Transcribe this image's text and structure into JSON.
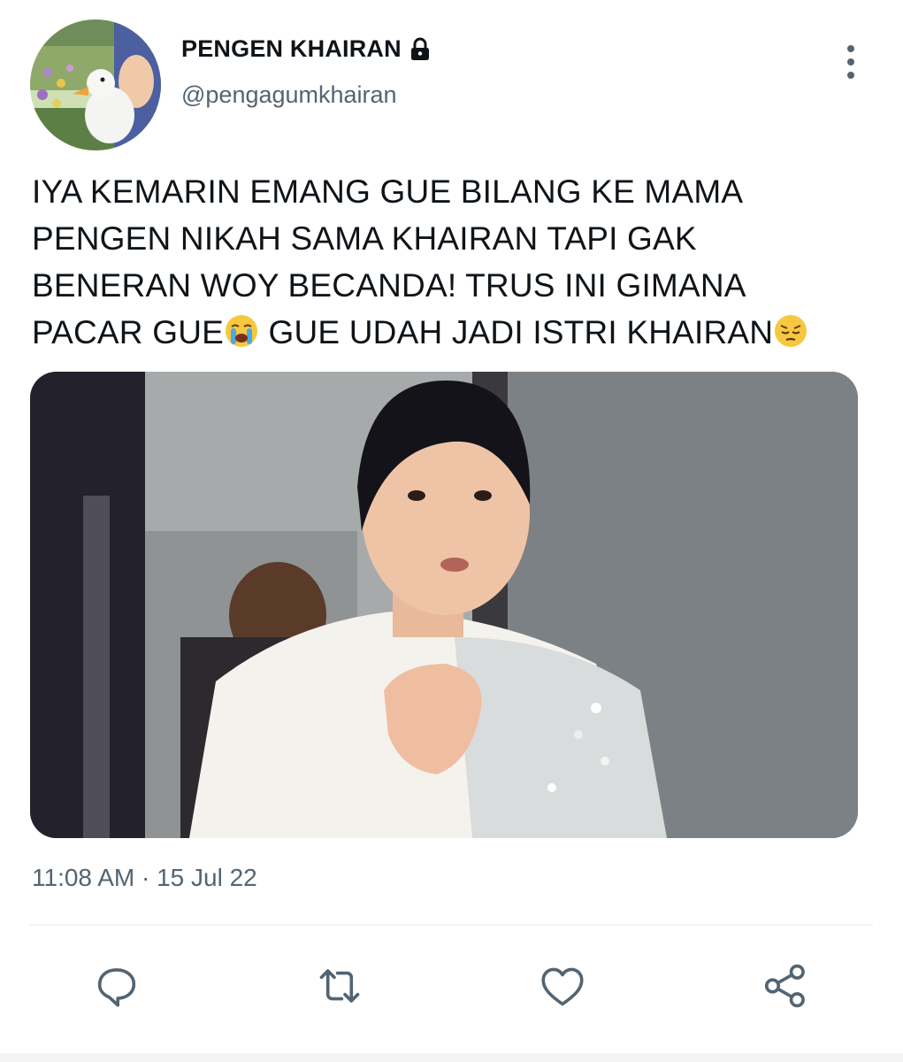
{
  "user": {
    "display_name": "PENGEN KHAIRAN",
    "handle": "@pengagumkhairan",
    "protected_icon": "lock-icon",
    "avatar": "avatar-duck-photo"
  },
  "tweet": {
    "lines": [
      "IYA KEMARIN EMANG GUE BILANG KE MAMA",
      "PENGEN NIKAH SAMA KHAIRAN TAPI GAK",
      "BENERAN WOY BECANDA! TRUS INI GIMANA"
    ],
    "last_line_part1": "PACAR GUE",
    "last_line_part2": " GUE UDAH JADI ISTRI KHAIRAN",
    "emoji_1": "😭",
    "emoji_2": "😔",
    "media": "photo-man-in-white-outfit",
    "timestamp": "11:08 AM · 15 Jul 22"
  },
  "actions": {
    "reply_icon": "reply-icon",
    "retweet_icon": "retweet-icon",
    "like_icon": "heart-icon",
    "share_icon": "share-icon",
    "more_icon": "more-vertical-icon"
  },
  "colors": {
    "text": "#0f1419",
    "secondary": "#536471",
    "divider": "#eff3f4"
  }
}
